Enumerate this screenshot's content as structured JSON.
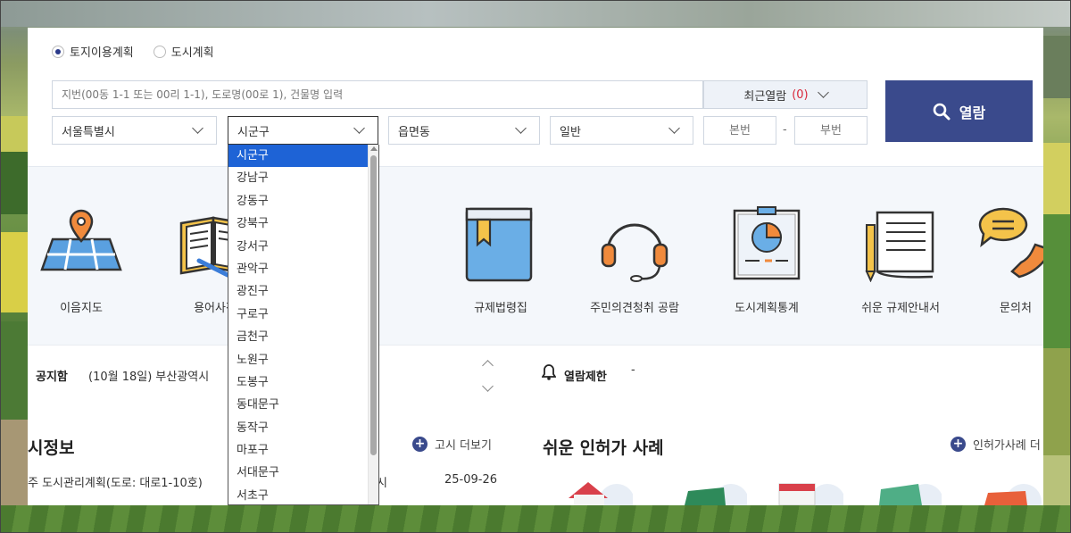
{
  "search": {
    "radio_land": "토지이용계획",
    "radio_city": "도시계획",
    "address_placeholder": "지번(00동 1-1 또는 00리 1-1), 도로명(00로 1), 건물명 입력",
    "recent_label": "최근열람",
    "recent_count": "(0)",
    "sido": "서울특별시",
    "sigungu": "시군구",
    "eupmyeondong": "읍면동",
    "land_type": "일반",
    "bonbeon_placeholder": "본번",
    "bubeon_placeholder": "부번",
    "dash": "-",
    "search_button": "열람"
  },
  "dropdown": {
    "items": [
      "시군구",
      "강남구",
      "강동구",
      "강북구",
      "강서구",
      "관악구",
      "광진구",
      "구로구",
      "금천구",
      "노원구",
      "도봉구",
      "동대문구",
      "동작구",
      "마포구",
      "서대문구",
      "서초구"
    ],
    "selected_index": 0
  },
  "quick": {
    "items": [
      {
        "label": "이음지도",
        "icon": "map-pin-icon"
      },
      {
        "label": "용어사전",
        "icon": "open-book-icon"
      },
      {
        "label": "규제법령집",
        "icon": "law-book-icon"
      },
      {
        "label": "주민의견청취 공람",
        "icon": "headset-icon"
      },
      {
        "label": "도시계획통계",
        "icon": "stats-board-icon"
      },
      {
        "label": "쉬운 규제안내서",
        "icon": "document-pencil-icon"
      },
      {
        "label": "문의처",
        "icon": "phone-chat-icon"
      }
    ]
  },
  "notice": {
    "title": "공지함",
    "text": "(10월 18일) 부산광역시",
    "limit_label": "열람제한",
    "limit_value": "-"
  },
  "sections": {
    "left_title": "시정보",
    "left_more": "고시 더보기",
    "left_row_text": "주 도시관리계획(도로: 대로1-10호)",
    "left_row_suffix": "시",
    "left_row_date": "25-09-26",
    "right_title": "쉬운 인허가 사례",
    "right_more": "인허가사례 더"
  },
  "colors": {
    "primary": "#3a4a8c",
    "selected": "#1e63d6",
    "alert": "#d9263a"
  }
}
